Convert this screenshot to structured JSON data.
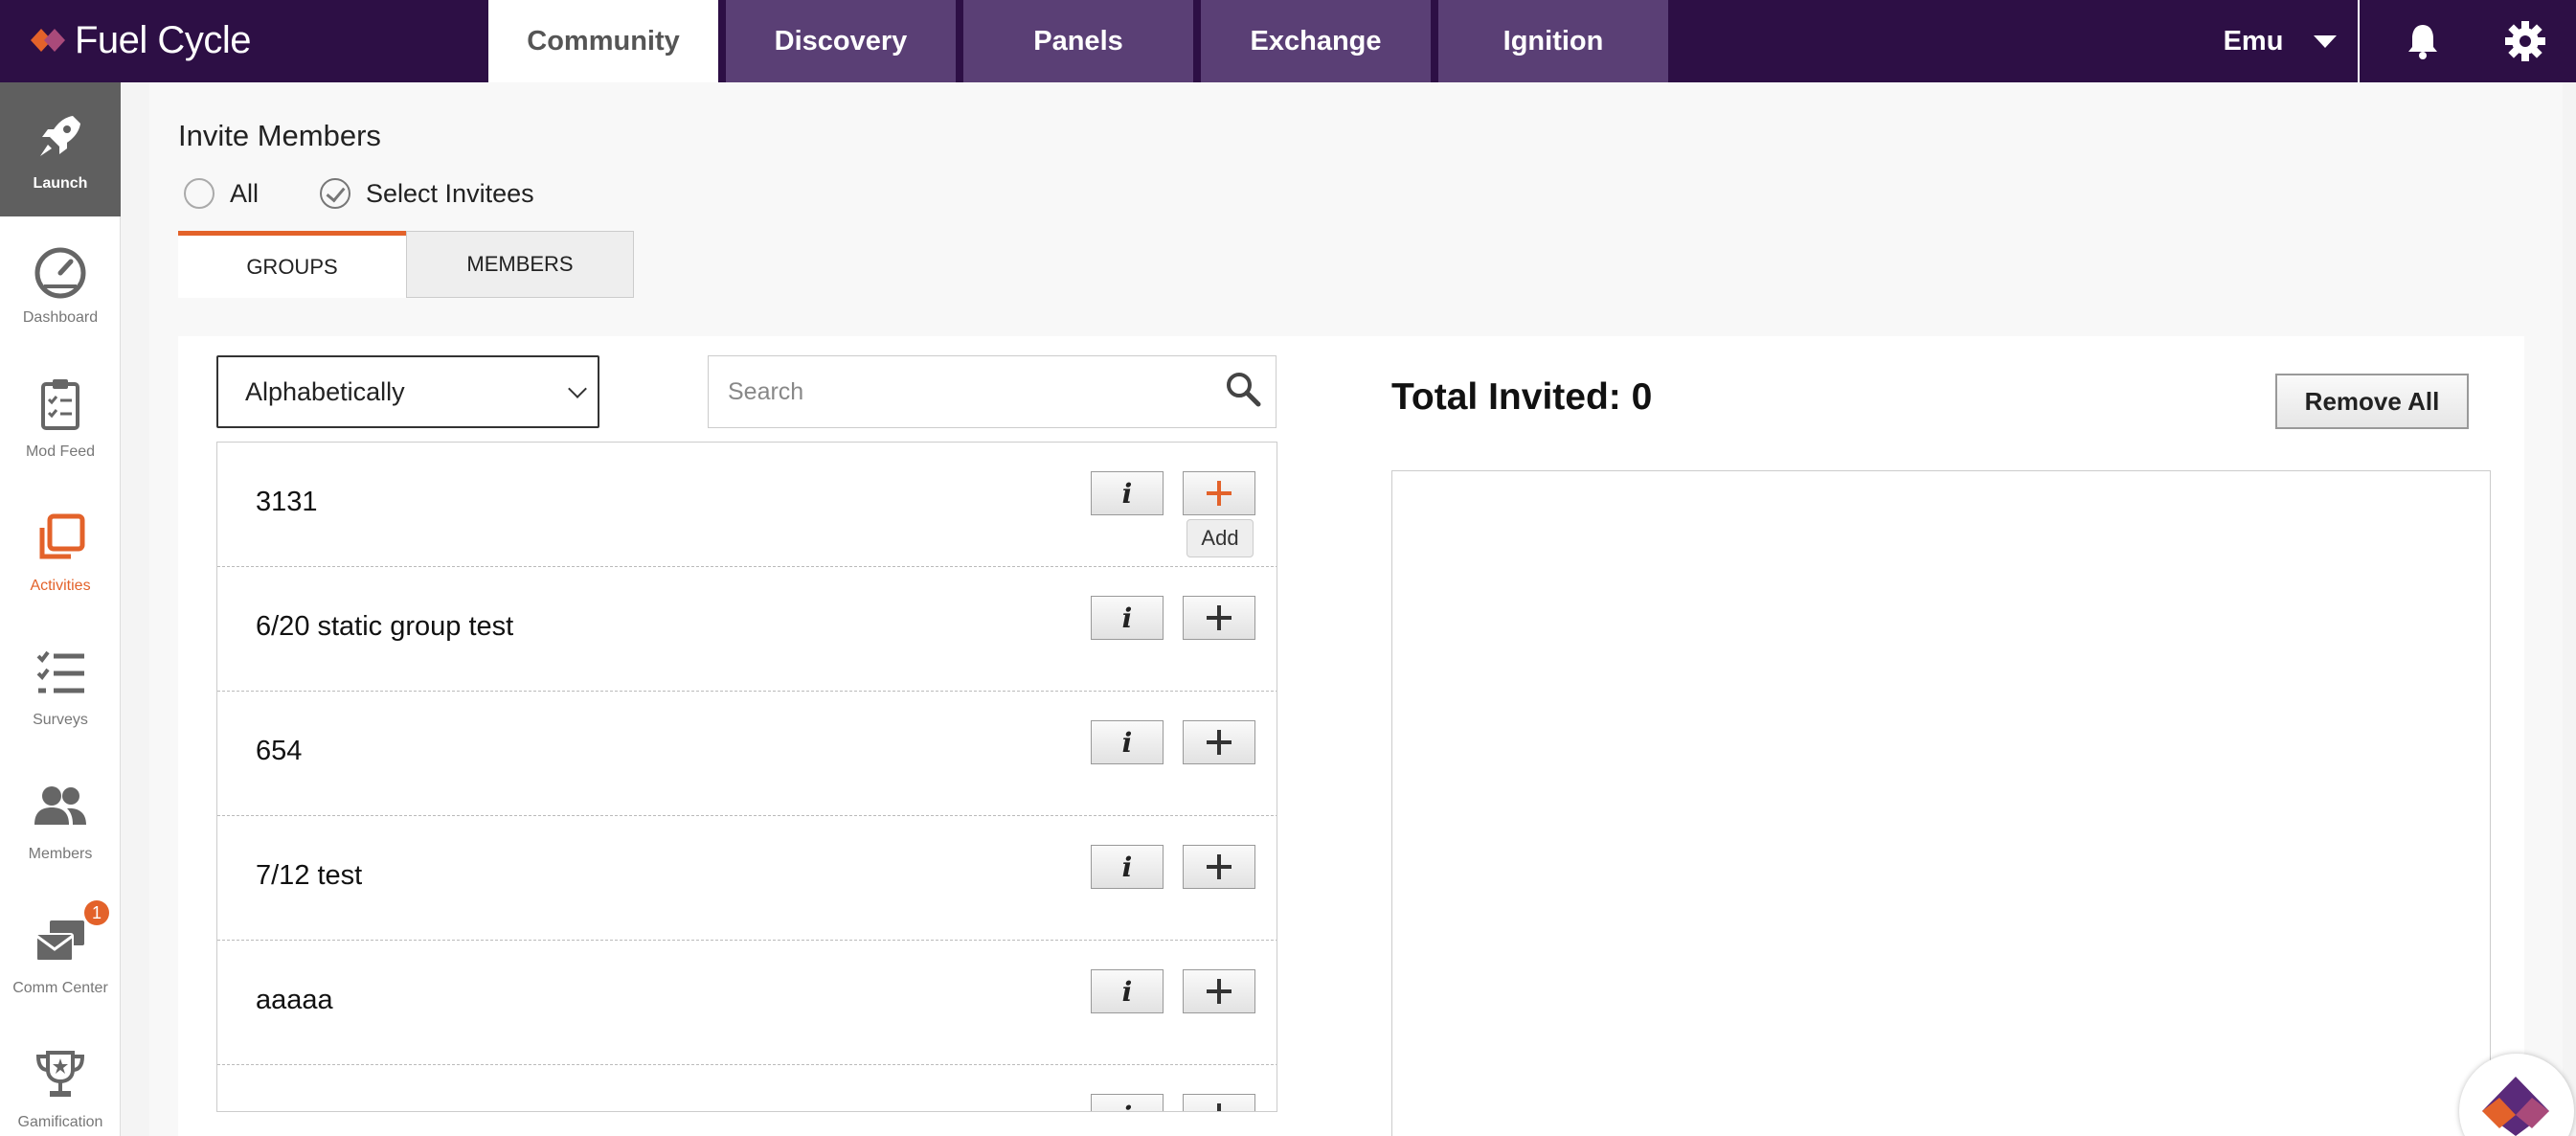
{
  "app": {
    "brand": "Fuel Cycle",
    "brand_colors": {
      "top_bar": "#2d0f45",
      "tab_inactive": "#5a3f75",
      "accent": "#e3622a"
    }
  },
  "topnav": {
    "tabs": [
      {
        "label": "Community",
        "active": true
      },
      {
        "label": "Discovery",
        "active": false
      },
      {
        "label": "Panels",
        "active": false
      },
      {
        "label": "Exchange",
        "active": false
      },
      {
        "label": "Ignition",
        "active": false
      }
    ],
    "user_name": "Emu",
    "icons": [
      "bell-icon",
      "gear-icon"
    ]
  },
  "sidebar": {
    "items": [
      {
        "label": "Launch",
        "icon": "rocket-icon",
        "active": true
      },
      {
        "label": "Dashboard",
        "icon": "gauge-icon"
      },
      {
        "label": "Mod Feed",
        "icon": "clipboard-icon"
      },
      {
        "label": "Activities",
        "icon": "layers-icon",
        "highlight": true
      },
      {
        "label": "Surveys",
        "icon": "checklist-icon"
      },
      {
        "label": "Members",
        "icon": "people-icon"
      },
      {
        "label": "Comm Center",
        "icon": "envelopes-icon",
        "badge": "1"
      },
      {
        "label": "Gamification",
        "icon": "trophy-icon"
      }
    ]
  },
  "main": {
    "title": "Invite Members",
    "radio_options": [
      {
        "label": "All",
        "selected": false
      },
      {
        "label": "Select Invitees",
        "selected": true
      }
    ],
    "subtabs": [
      {
        "label": "GROUPS",
        "active": true
      },
      {
        "label": "MEMBERS",
        "active": false
      }
    ],
    "sort": {
      "selected": "Alphabetically"
    },
    "search": {
      "placeholder": "Search"
    },
    "groups": [
      {
        "name": "3131"
      },
      {
        "name": "6/20 static group test"
      },
      {
        "name": "654"
      },
      {
        "name": "7/12 test"
      },
      {
        "name": "aaaaa"
      },
      {
        "name": ""
      }
    ],
    "add_tooltip": "Add",
    "total_invited": "Total Invited: 0",
    "remove_all_label": "Remove All"
  }
}
